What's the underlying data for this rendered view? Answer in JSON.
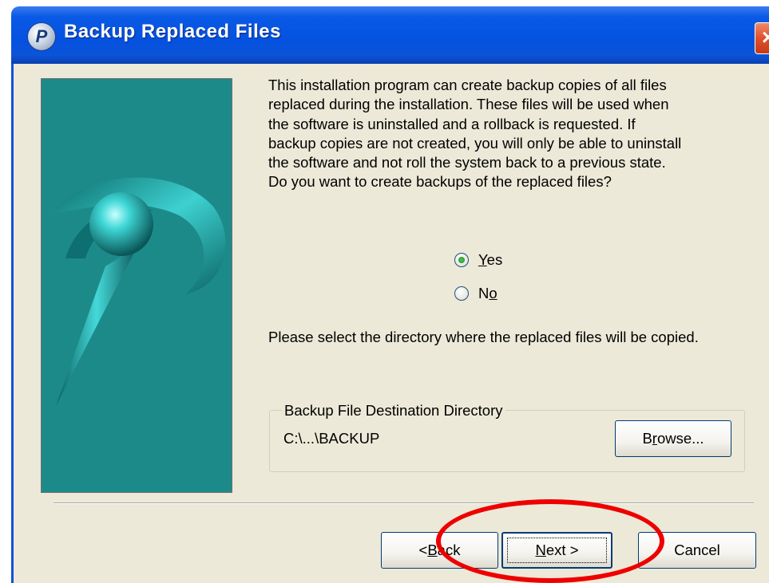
{
  "window": {
    "title": "Backup Replaced Files",
    "close_label": "×"
  },
  "body_text": "This installation program can create backup copies of all files\nreplaced during the installation. These files will be used when\nthe software is uninstalled and a rollback is requested.  If\nbackup copies are not created, you will only be able to uninstall\nthe software and not roll the system back to a previous state.\nDo you want to create backups of the replaced files?",
  "options": {
    "yes": {
      "label_u": "Y",
      "label_rest": "es",
      "selected": true
    },
    "no": {
      "label_pre": "N",
      "label_u": "o",
      "selected": false
    }
  },
  "select_text": "Please select the directory where the replaced  files will be copied.",
  "group": {
    "legend": "Backup File Destination Directory",
    "path": "C:\\...\\BACKUP",
    "browse_pre": "B",
    "browse_u": "r",
    "browse_rest": "owse..."
  },
  "buttons": {
    "back_pre": "< ",
    "back_u": "B",
    "back_rest": "ack",
    "next_u": "N",
    "next_rest": "ext >",
    "cancel": "Cancel"
  },
  "colors": {
    "titlebar": "#0551e0",
    "dialog_bg": "#ece9d8",
    "side_image_bg": "#1d8a8a",
    "highlight": "#ee0000"
  }
}
